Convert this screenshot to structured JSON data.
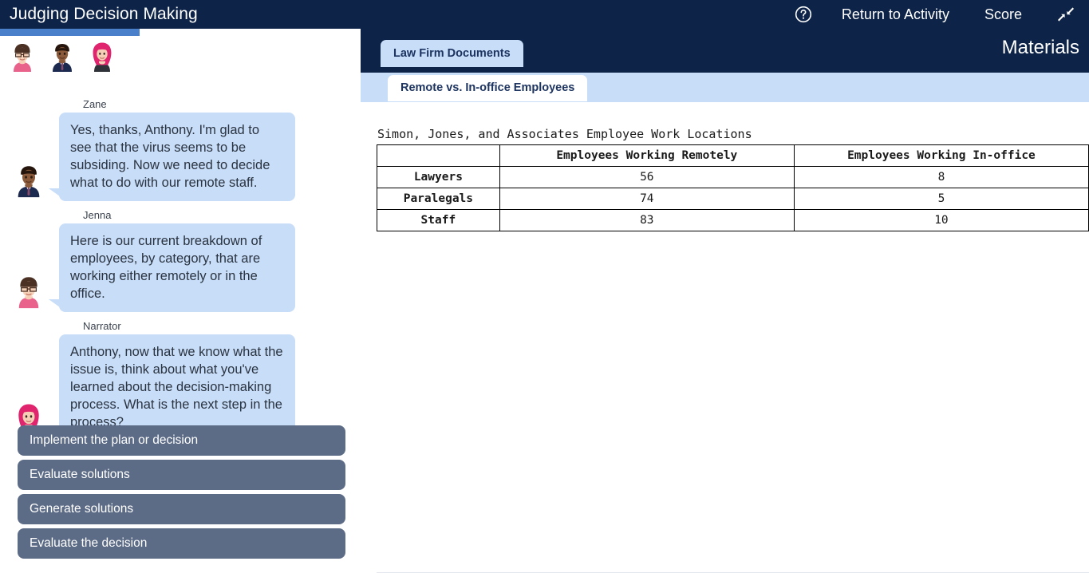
{
  "app": {
    "title": "Judging Decision Making"
  },
  "topbar": {
    "help_icon": "help-circle-icon",
    "return_label": "Return to Activity",
    "score_label": "Score",
    "collapse_icon": "collapse-arrows-icon"
  },
  "progress": {
    "percent": 38.7
  },
  "characters": [
    {
      "name": "Jenna",
      "icon": "avatar-woman-glasses"
    },
    {
      "name": "Zane",
      "icon": "avatar-man-suit"
    },
    {
      "name": "Narrator",
      "icon": "avatar-woman-hijab"
    }
  ],
  "conversation": [
    {
      "speaker": "Zane",
      "avatar": "avatar-man-suit",
      "text": "Yes, thanks, Anthony. I'm glad to see that the virus seems to be subsiding. Now we need to decide what to do with our remote staff."
    },
    {
      "speaker": "Jenna",
      "avatar": "avatar-woman-glasses",
      "text": "Here is our current breakdown of employees, by category, that are working either remotely or in the office."
    },
    {
      "speaker": "Narrator",
      "avatar": "avatar-woman-hijab",
      "text": "Anthony, now that we know what the issue is, think about what you've learned about the decision-making process. What is the next step in the process?"
    }
  ],
  "choices": [
    {
      "label": "Implement the plan or decision"
    },
    {
      "label": "Evaluate solutions"
    },
    {
      "label": "Generate solutions"
    },
    {
      "label": "Evaluate the decision"
    }
  ],
  "materials": {
    "panel_label": "Materials",
    "primary_tab": "Law Firm Documents",
    "secondary_tab": "Remote vs. In-office Employees"
  },
  "document": {
    "title": "Simon, Jones, and Associates Employee Work Locations",
    "table": {
      "corner": "",
      "columns": [
        "Employees Working Remotely",
        "Employees Working In-office"
      ],
      "rows": [
        {
          "label": "Lawyers",
          "values": [
            "56",
            "8"
          ]
        },
        {
          "label": "Paralegals",
          "values": [
            "74",
            "5"
          ]
        },
        {
          "label": "Staff",
          "values": [
            "83",
            "10"
          ]
        }
      ]
    }
  },
  "colors": {
    "navy": "#0d2347",
    "bubble": "#c8ddf8",
    "choice": "#5c6b86",
    "progress": "#4a7fca"
  }
}
